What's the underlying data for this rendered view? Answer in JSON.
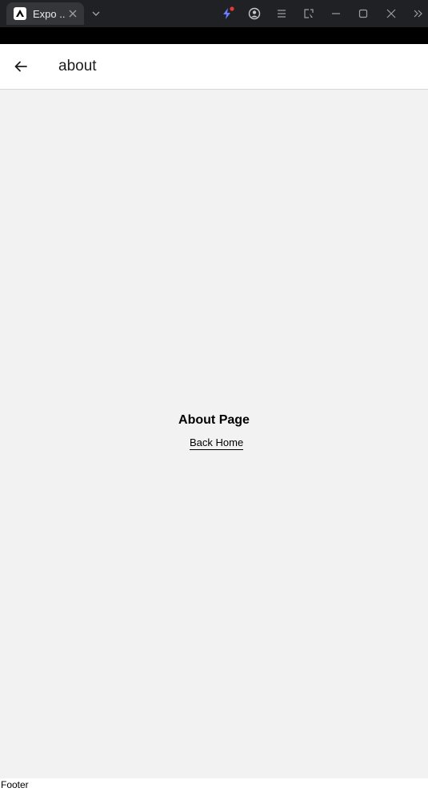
{
  "browser": {
    "tab_title": "Expo ...",
    "icons": {
      "favicon": "expo-logo-icon",
      "tab_close": "close-icon",
      "tab_list": "chevron-down-icon",
      "extension": "lightning-icon",
      "profile": "account-circle-icon",
      "menu": "menu-icon",
      "screenshot": "select-area-icon",
      "minimize": "minimize-icon",
      "maximize": "maximize-icon",
      "close": "close-icon",
      "more": "double-chevron-right-icon"
    },
    "colors": {
      "titlebar": "#202124",
      "tab": "#35363a",
      "notification_dot": "#e53935",
      "extension_accent": "#6a7cff"
    }
  },
  "header": {
    "title": "about",
    "back_icon": "arrow-left-icon"
  },
  "main": {
    "title": "About Page",
    "back_link": "Back Home"
  },
  "footer": {
    "text": "Footer"
  }
}
